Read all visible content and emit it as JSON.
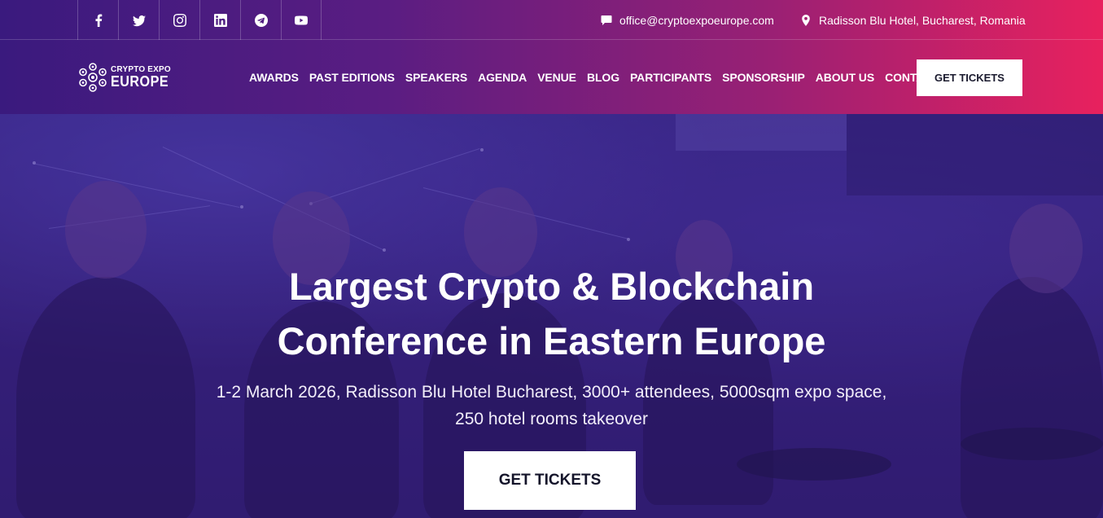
{
  "topbar": {
    "socials": [
      {
        "icon": "facebook-icon"
      },
      {
        "icon": "twitter-icon"
      },
      {
        "icon": "instagram-icon"
      },
      {
        "icon": "linkedin-icon"
      },
      {
        "icon": "telegram-icon"
      },
      {
        "icon": "youtube-icon"
      }
    ],
    "email": "office@cryptoexpoeurope.com",
    "location": "Radisson Blu Hotel, Bucharest, Romania"
  },
  "logo": {
    "line1": "CRYPTO EXPO",
    "line2": "EUROPE"
  },
  "nav": {
    "items": [
      "AWARDS",
      "PAST EDITIONS",
      "SPEAKERS",
      "AGENDA",
      "VENUE",
      "BLOG",
      "PARTICIPANTS",
      "SPONSORSHIP",
      "ABOUT US",
      "CONTACT"
    ],
    "cta": "GET TICKETS"
  },
  "hero": {
    "title_line1": "Largest Crypto & Blockchain",
    "title_line2": "Conference in Eastern Europe",
    "subtitle_line1": "1-2 March 2026, Radisson Blu Hotel Bucharest, 3000+ attendees, 5000sqm expo space,",
    "subtitle_line2": "250 hotel rooms takeover",
    "cta": "GET TICKETS"
  },
  "colors": {
    "gradient_start": "#3a1a7e",
    "gradient_end": "#e8215e",
    "hero_overlay": "#35217a",
    "button_bg": "#ffffff"
  }
}
